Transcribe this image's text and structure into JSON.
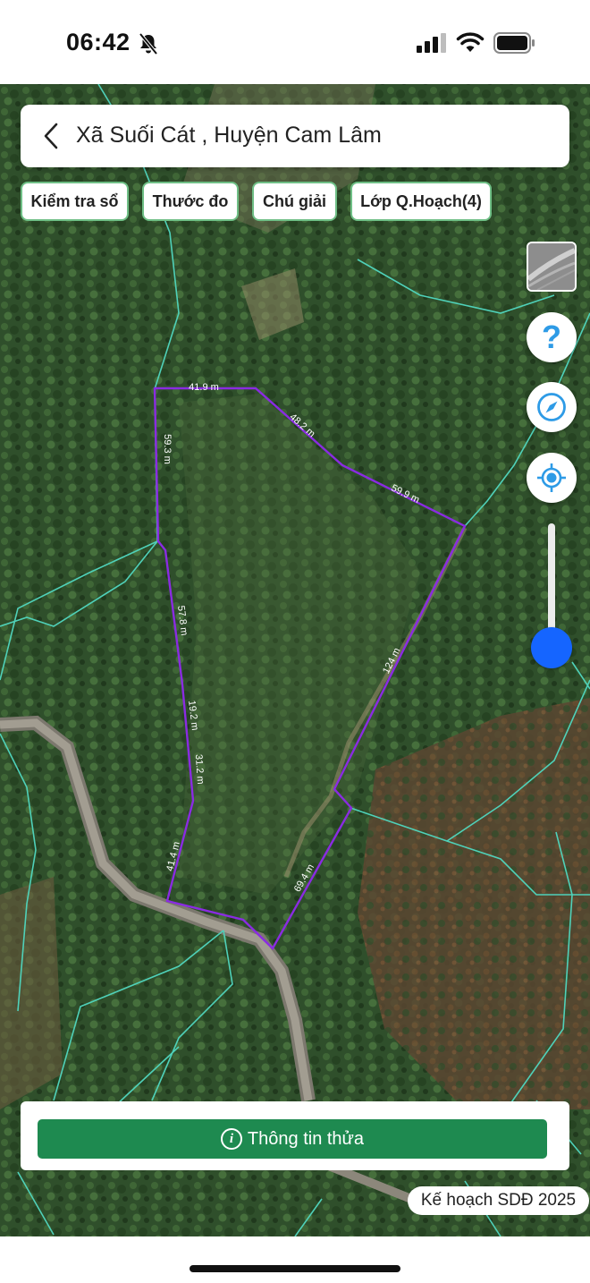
{
  "status_bar": {
    "time": "06:42",
    "icons": [
      "bell-slash-icon",
      "cellular-signal-icon",
      "wifi-icon",
      "battery-icon"
    ]
  },
  "search_bar": {
    "title": "Xã Suối Cát , Huyện Cam Lâm",
    "back_icon": "chevron-left-icon"
  },
  "chips": [
    {
      "label": "Kiểm tra sổ"
    },
    {
      "label": "Thước đo"
    },
    {
      "label": "Chú giải"
    },
    {
      "label": "Lớp Q.Hoạch(4)"
    }
  ],
  "map_controls": {
    "layer_thumbnail_icon": "map-layer-thumbnail",
    "help_glyph": "?",
    "help_icon": "help-icon",
    "compass_icon": "compass-icon",
    "locate_icon": "locate-target-icon",
    "zoom_level_fraction": 0.86
  },
  "parcel": {
    "outline_color": "#8a2be2",
    "edge_labels": [
      "41.9 m",
      "48.2 m",
      "59.9 m",
      "59.3 m",
      "57.8 m",
      "19.2 m",
      "31.2 m",
      "41.4 m",
      "124 m",
      "69.4 m"
    ]
  },
  "colors": {
    "boundary_lines": "#4fd1b9",
    "primary_green": "#1e8a50",
    "accent_blue": "#1565ff",
    "icon_blue": "#2e9be6"
  },
  "bottom": {
    "info_button_label": "Thông tin thửa",
    "info_icon_glyph": "i",
    "plan_badge": "Kế hoạch SDĐ 2025"
  }
}
